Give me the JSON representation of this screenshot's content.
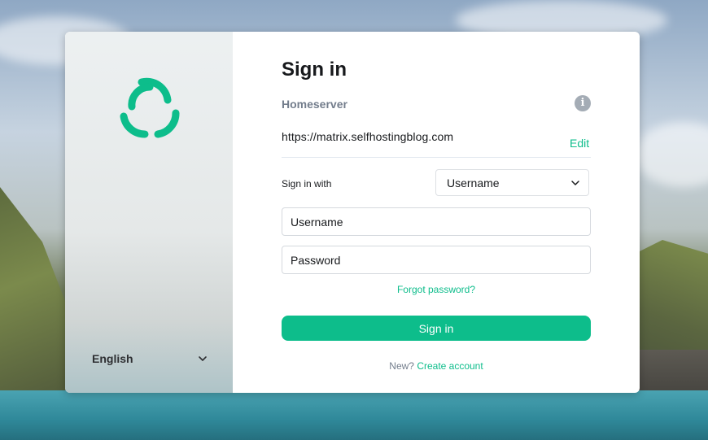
{
  "colors": {
    "accent": "#0dbd8b",
    "muted": "#737d8c",
    "text": "#17191c"
  },
  "sidebar": {
    "logo_icon": "element-logo-icon",
    "language": "English"
  },
  "form": {
    "title": "Sign in",
    "homeserver_label": "Homeserver",
    "homeserver_url": "https://matrix.selfhostingblog.com",
    "info_icon": "i",
    "edit_label": "Edit",
    "signin_with_label": "Sign in with",
    "signin_with_selected": "Username",
    "username_placeholder": "Username",
    "password_placeholder": "Password",
    "forgot_password": "Forgot password?",
    "submit_label": "Sign in",
    "new_prompt": "New?",
    "create_account": "Create account"
  }
}
